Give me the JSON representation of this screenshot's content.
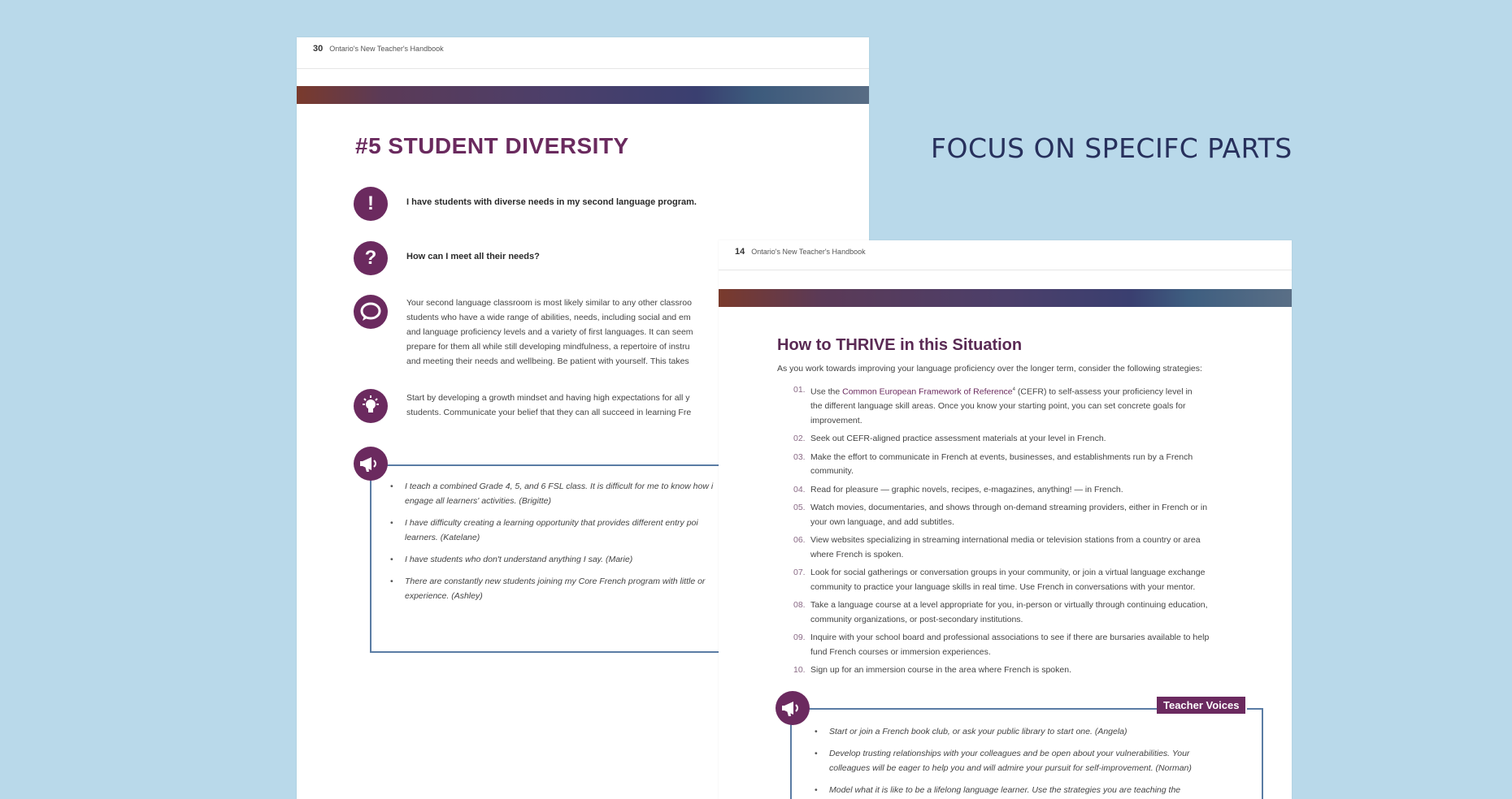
{
  "focus_heading": "FOCUS ON SPECIFC PARTS",
  "back_page": {
    "page_number": "30",
    "running_header": "Ontario's New Teacher's Handbook",
    "title": "#5 STUDENT DIVERSITY",
    "statement": "I have students with diverse needs in my second language program.",
    "question": "How can I meet all their needs?",
    "paragraph_lines": [
      "Your second language classroom is most likely similar to any other classroo",
      "students who have a wide range of abilities, needs, including social and em",
      "and language proficiency levels and a variety of first languages. It can seem",
      "prepare for them all while still developing mindfulness, a repertoire of instru",
      "and meeting their needs and wellbeing. Be patient with yourself. This takes"
    ],
    "tip_lines": [
      "Start by developing a growth mindset and having high expectations for all y",
      "students. Communicate your belief that they can all succeed in learning Fre"
    ],
    "voices": [
      {
        "line1": "I teach a combined Grade 4, 5, and 6 FSL class. It is difficult for me to know how i",
        "line2": "engage all learners' activities. (Brigitte)"
      },
      {
        "line1": "I have difficulty creating a learning opportunity that provides different entry poi",
        "line2": "learners. (Katelane)"
      },
      {
        "line1": "I have students who don't understand anything I say. (Marie)",
        "line2": ""
      },
      {
        "line1": "There are constantly new students joining my Core French program with little or",
        "line2": "experience. (Ashley)"
      }
    ]
  },
  "front_page": {
    "page_number": "14",
    "running_header": "Ontario's New Teacher's Handbook",
    "title": "How to THRIVE in this Situation",
    "intro": "As you work towards improving your language proficiency over the longer term, consider the following strategies:",
    "strategies": [
      {
        "num": "01.",
        "pre": "Use the ",
        "link": "Common European Framework of Reference",
        "sup": "4",
        "post": " (CEFR) to self-assess your proficiency level in",
        "lines": [
          "the different language skill areas. Once you know your starting point, you can set concrete goals for",
          "improvement."
        ]
      },
      {
        "num": "02.",
        "pre": "Seek out CEFR-aligned practice assessment materials at your level in French.",
        "lines": []
      },
      {
        "num": "03.",
        "pre": "Make the effort to communicate in French at events, businesses, and establishments run by a French",
        "lines": [
          "community."
        ]
      },
      {
        "num": "04.",
        "pre": "Read for pleasure — graphic novels, recipes, e-magazines, anything! — in French.",
        "lines": []
      },
      {
        "num": "05.",
        "pre": "Watch movies, documentaries, and shows through on-demand streaming providers, either in French or in",
        "lines": [
          "your own language, and add subtitles."
        ]
      },
      {
        "num": "06.",
        "pre": "View websites specializing in streaming international media or television stations from a country or area",
        "lines": [
          "where French is spoken."
        ]
      },
      {
        "num": "07.",
        "pre": "Look for social gatherings or conversation groups in your community, or join a virtual language exchange",
        "lines": [
          "community to practice your language skills in real time. Use French in conversations with your mentor."
        ]
      },
      {
        "num": "08.",
        "pre": "Take a language course at a level appropriate for you, in-person or virtually through continuing education,",
        "lines": [
          "community organizations, or post-secondary institutions."
        ]
      },
      {
        "num": "09.",
        "pre": "Inquire with your school board and professional associations to see if there are bursaries available to help",
        "lines": [
          "fund French courses or immersion experiences."
        ]
      },
      {
        "num": "10.",
        "pre": "Sign up for an immersion course in the area where French is spoken.",
        "lines": []
      }
    ],
    "teacher_voices_label": "Teacher Voices",
    "voices": [
      {
        "line1": "Start or join a French book club, or ask your public library to start one. (Angela)",
        "line2": ""
      },
      {
        "line1": "Develop trusting relationships with your colleagues and be open about your vulnerabilities. Your",
        "line2": "colleagues will be eager to help you and will admire your pursuit for self-improvement. (Norman)"
      },
      {
        "line1": "Model what it is like to be a lifelong language learner. Use the strategies you are teaching the",
        "line2": ""
      }
    ]
  }
}
